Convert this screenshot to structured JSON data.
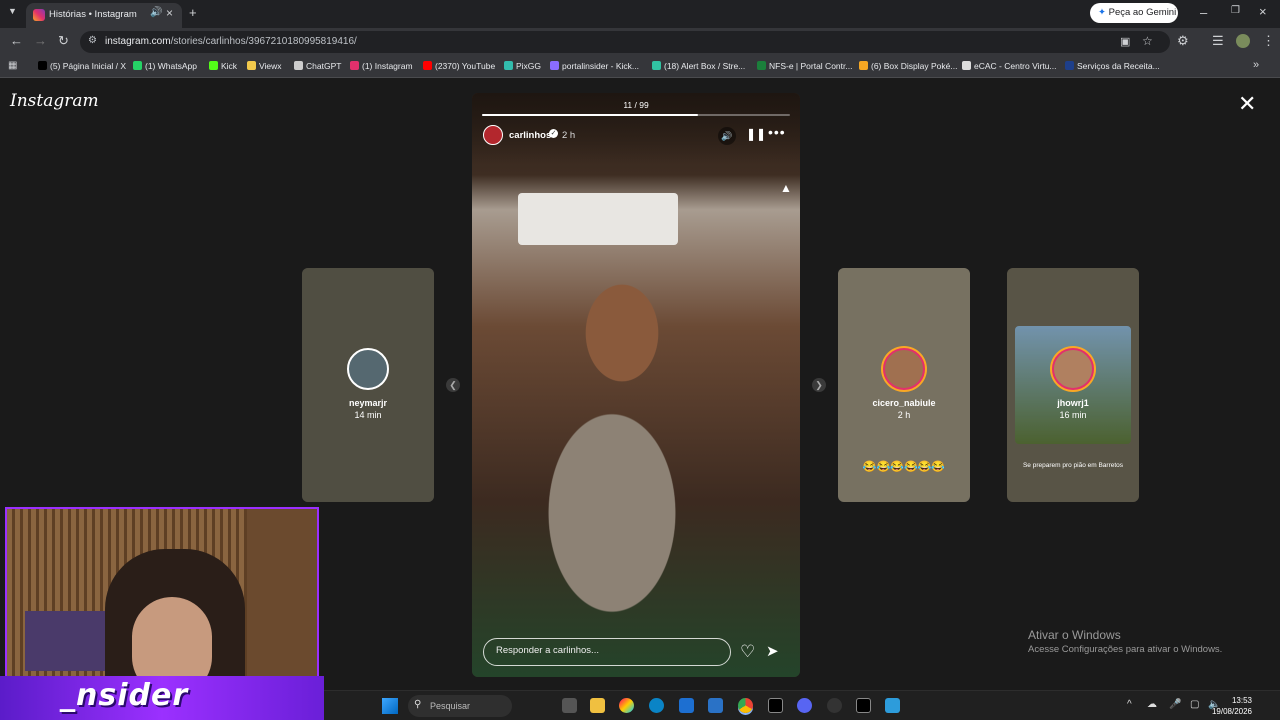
{
  "browser": {
    "tab_title": "Histórias • Instagram",
    "gemini_label": "Peça ao Gemini",
    "url_host": "instagram.com",
    "url_path": "/stories/carlinhos/3967210180995819416/"
  },
  "bookmarks": [
    {
      "label": "(5) Página Inicial / X",
      "color": "#000000"
    },
    {
      "label": "(1) WhatsApp",
      "color": "#25d366"
    },
    {
      "label": "Kick",
      "color": "#53fc18"
    },
    {
      "label": "Viewx",
      "color": "#f2c94c"
    },
    {
      "label": "ChatGPT",
      "color": "#cccccc"
    },
    {
      "label": "(1) Instagram",
      "color": "#e1306c"
    },
    {
      "label": "(2370) YouTube",
      "color": "#ff0000"
    },
    {
      "label": "PixGG",
      "color": "#32bcad"
    },
    {
      "label": "portalinsider - Kick...",
      "color": "#8a6cff"
    },
    {
      "label": "(18) Alert Box / Stre...",
      "color": "#31c3a2"
    },
    {
      "label": "NFS-e | Portal Contr...",
      "color": "#1b7f3b"
    },
    {
      "label": "(6) Box Display Poké...",
      "color": "#f5a623"
    },
    {
      "label": "eCAC - Centro Virtu...",
      "color": "#dddddd"
    },
    {
      "label": "Serviços da Receita...",
      "color": "#1e3f8a"
    }
  ],
  "instagram": {
    "logo": "Instagram",
    "story": {
      "counter": "11 / 99",
      "progress": 0.7,
      "username": "carlinhos",
      "time": "2 h",
      "reply_placeholder": "Responder a carlinhos..."
    },
    "side_stories": [
      {
        "username": "neymarjr",
        "time": "14 min",
        "bg": "#7b7866"
      },
      {
        "username": "cicero_nabiule",
        "time": "2 h",
        "bg": "#8c8573"
      },
      {
        "username": "jhowrj1",
        "time": "16 min",
        "bg": "#6f6a58"
      }
    ],
    "side_caption": "Se preparem pro pião em Barretos",
    "side_emojis": "😂😂😂😂😂😂"
  },
  "windows_watermark": {
    "title": "Ativar o Windows",
    "subtitle": "Acesse Configurações para ativar o Windows."
  },
  "overlay": {
    "banner_text": "_nsider"
  },
  "taskbar": {
    "search_label": "Pesquisar",
    "time": "13:53",
    "date": "19/08/2026"
  },
  "colors": {
    "accent_twitch": "#9b30ff",
    "story_progress": "#ffffff"
  }
}
